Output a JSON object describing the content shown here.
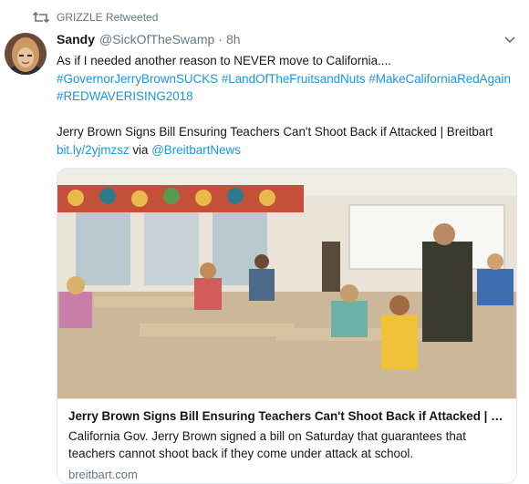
{
  "retweet": {
    "icon": "retweet-icon",
    "label": "GRIZZLE Retweeted"
  },
  "tweet": {
    "display_name": "Sandy",
    "handle": "@SickOfTheSwamp",
    "separator": "·",
    "time": "8h",
    "text_line1": "As if I needed another reason to NEVER move to California....",
    "hashtags_line1": "#GovernorJerryBrownSUCKS #LandOfTheFruitsandNuts #MakeCaliforniaRedAgain",
    "hashtags_line2": "#REDWAVERISING2018",
    "headline": "Jerry Brown Signs Bill Ensuring Teachers Can't Shoot Back if Attacked | Breitbart",
    "short_link": "bit.ly/2yjmzsz",
    "via": "via",
    "via_account": "@BreitbartNews"
  },
  "card": {
    "title": "Jerry Brown Signs Bill Ensuring Teachers Can't Shoot Back if Attacked | Breitbart",
    "description": "California Gov. Jerry Brown signed a bill on Saturday that guarantees that teachers cannot shoot back if they come under attack at school.",
    "domain": "breitbart.com"
  },
  "colors": {
    "link": "#1b95e0",
    "muted": "#657786",
    "text": "#14171a",
    "border": "#e1e8ed"
  }
}
